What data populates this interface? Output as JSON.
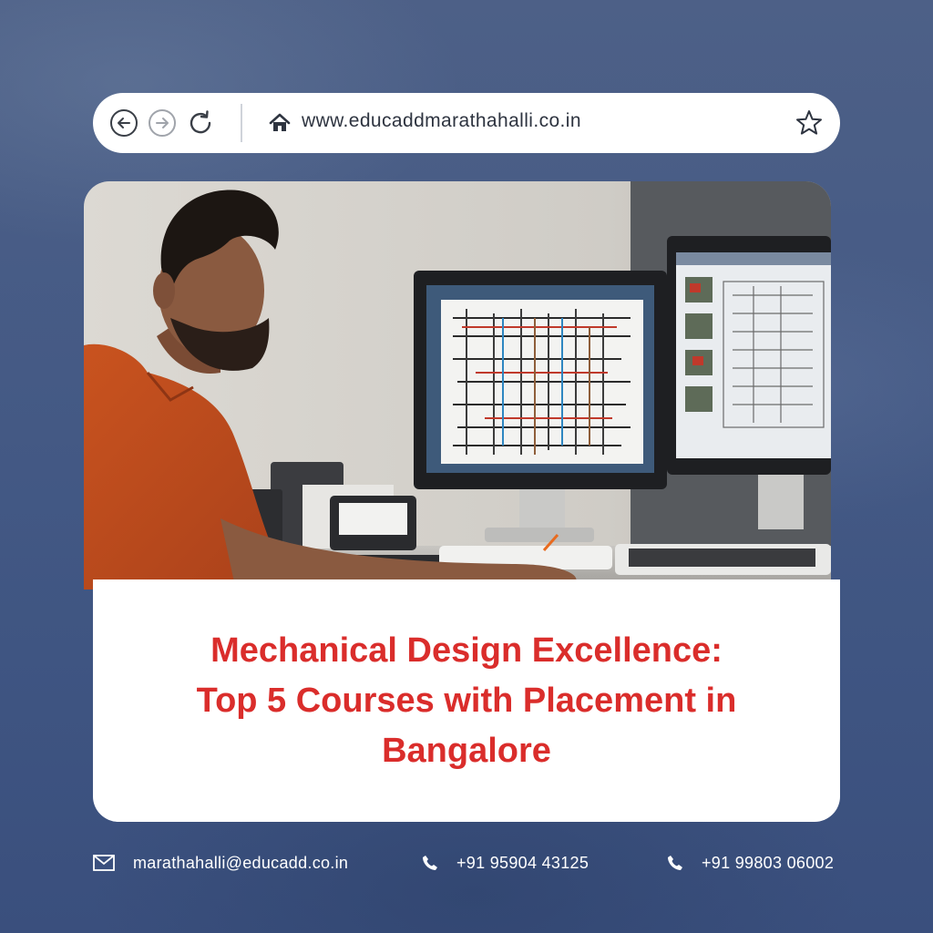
{
  "browser": {
    "url": "www.educaddmarathahalli.co.in",
    "icons": [
      "back-arrow-icon",
      "forward-arrow-icon",
      "reload-icon",
      "home-icon",
      "star-icon"
    ]
  },
  "hero": {
    "image_subject": "man in orange shirt working at CAD workstation with two monitors"
  },
  "headline": {
    "line1": "Mechanical Design Excellence:",
    "line2": "Top 5 Courses with Placement in",
    "line3": "Bangalore"
  },
  "contacts": {
    "email": "marathahalli@educadd.co.in",
    "phone1": "+91 95904 43125",
    "phone2": "+91 99803 06002"
  },
  "colors": {
    "background": "#455a85",
    "headline": "#da2d2b",
    "card": "#ffffff"
  }
}
